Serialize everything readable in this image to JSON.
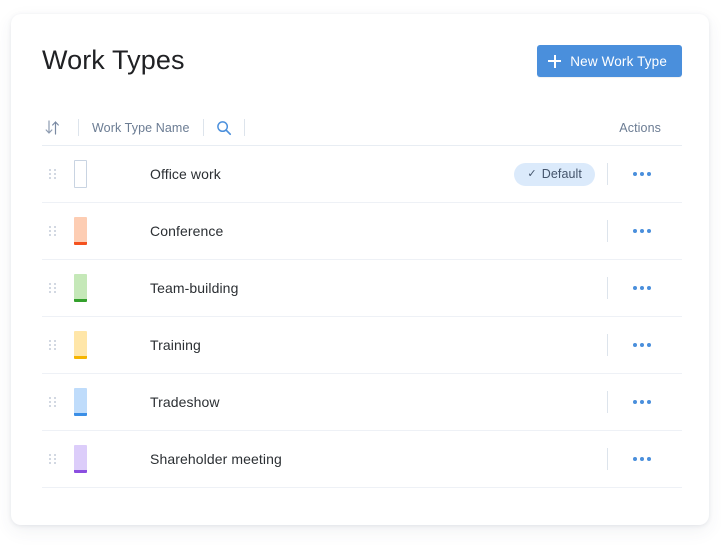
{
  "header": {
    "title": "Work Types",
    "new_button_label": "New Work Type",
    "new_button_icon": "plus-icon",
    "accent_color": "#4a8fdc"
  },
  "table": {
    "sort_icon": "sort-arrows-icon",
    "column_name_label": "Work Type Name",
    "search_icon": "search-icon",
    "actions_label": "Actions",
    "row_actions_icon": "ellipsis-icon",
    "drag_handle_icon": "drag-handle-icon",
    "rows": [
      {
        "name": "Office work",
        "color_fill": "#ffffff",
        "color_bar": "",
        "color_border": "#c9d4e2",
        "badge": "Default",
        "badge_check": "✓"
      },
      {
        "name": "Conference",
        "color_fill": "#fdcdb3",
        "color_bar": "#f4511e",
        "color_border": "",
        "badge": "",
        "badge_check": ""
      },
      {
        "name": "Team-building",
        "color_fill": "#c5e8b8",
        "color_bar": "#33a02c",
        "color_border": "",
        "badge": "",
        "badge_check": ""
      },
      {
        "name": "Training",
        "color_fill": "#ffe6a8",
        "color_bar": "#f5b400",
        "color_border": "",
        "badge": "",
        "badge_check": ""
      },
      {
        "name": "Tradeshow",
        "color_fill": "#bfdcfb",
        "color_bar": "#3a8ee6",
        "color_border": "",
        "badge": "",
        "badge_check": ""
      },
      {
        "name": "Shareholder meeting",
        "color_fill": "#dccdfa",
        "color_bar": "#8b4ee0",
        "color_border": "",
        "badge": "",
        "badge_check": ""
      }
    ]
  }
}
